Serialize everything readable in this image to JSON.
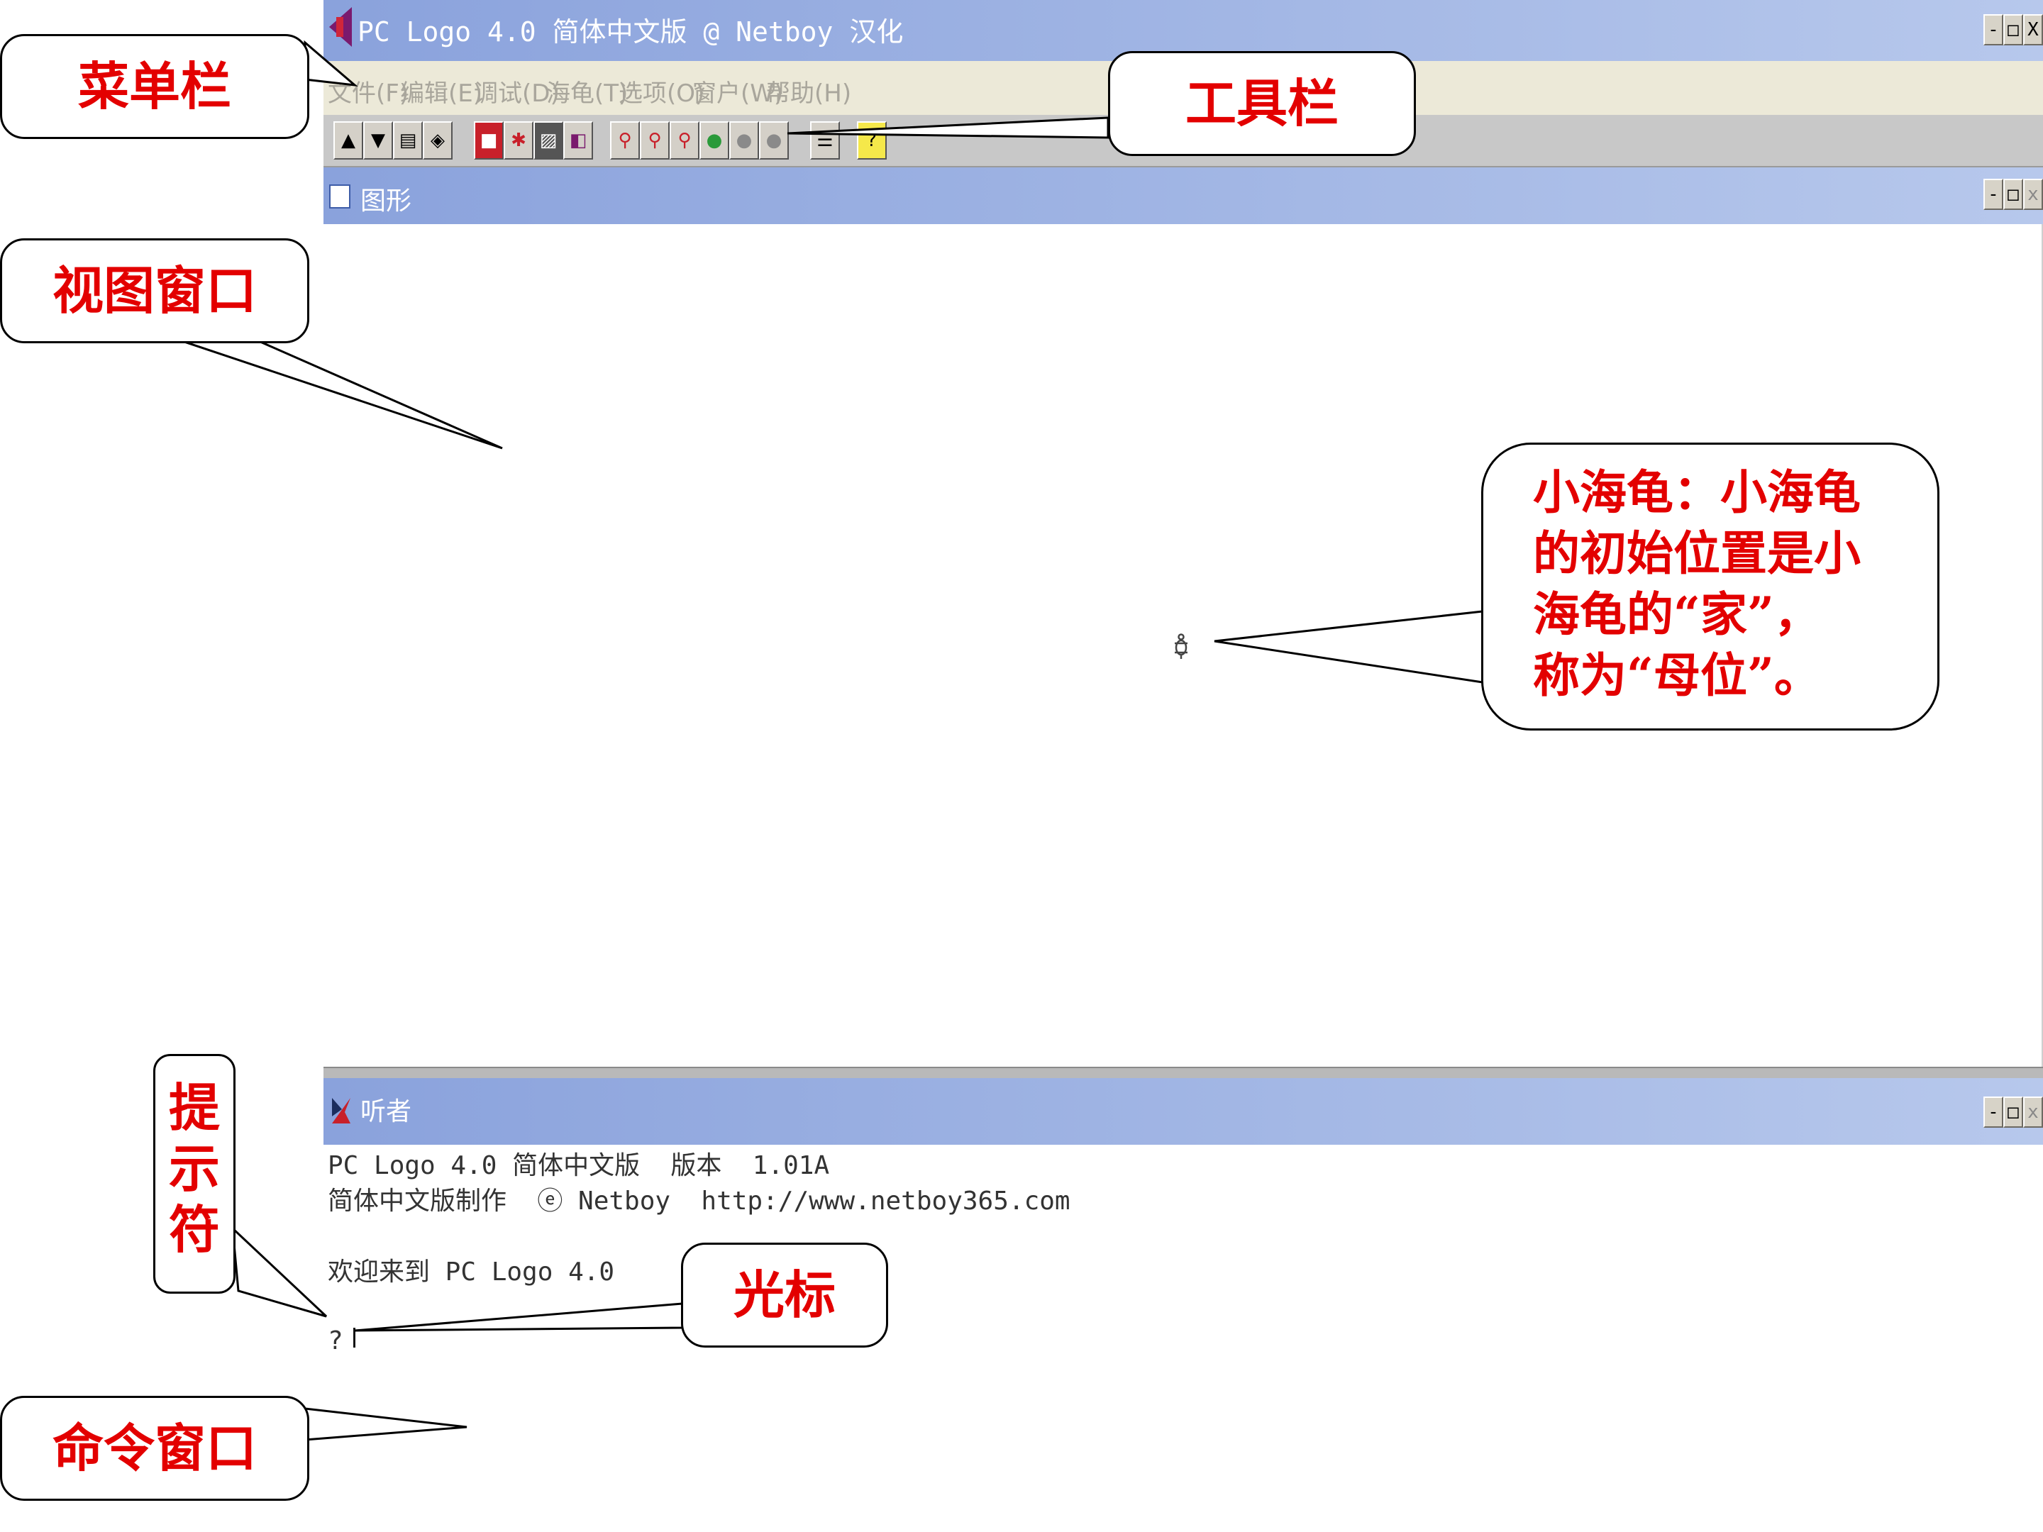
{
  "window": {
    "title": "PC Logo 4.0 简体中文版 @ Netboy 汉化",
    "controls": [
      "-",
      "□",
      "X"
    ]
  },
  "menu": [
    "文件(F)",
    "编辑(E)",
    "调试(D)",
    "海龟(T)",
    "选项(O)",
    "窗户(W)",
    "帮助(H)"
  ],
  "toolbar": {
    "help_glyph": "?",
    "buttons": [
      "open",
      "save",
      "print",
      "edit",
      "stop",
      "bug",
      "pattern",
      "trace",
      "zoom-1",
      "zoom-2",
      "zoom-3",
      "light-1",
      "light-2",
      "light-3",
      "window",
      "help"
    ]
  },
  "graphics": {
    "title": "图形",
    "controls": [
      "-",
      "□",
      "x"
    ]
  },
  "listener": {
    "title": "听者",
    "controls": [
      "-",
      "□",
      "x"
    ],
    "lines": [
      "PC Logo 4.0 简体中文版  版本  1.01A",
      "简体中文版制作  ⓔ Netboy  http://www.netboy365.com",
      "",
      "欢迎来到 PC Logo 4.0"
    ],
    "prompt": "?"
  },
  "annotations": {
    "menubar": "菜单栏",
    "toolbar": "工具栏",
    "view_window": "视图窗口",
    "turtle": [
      "小海龟：小海龟",
      "的初始位置是小",
      "海龟的“家”，",
      "称为“母位”。"
    ],
    "prompt": [
      "提",
      "示",
      "符"
    ],
    "cursor": "光标",
    "command_window": "命令窗口"
  },
  "colors": {
    "annotation_text": "#e30000",
    "titlebar_start": "#8aa2dc",
    "titlebar_end": "#b7c8ec"
  }
}
